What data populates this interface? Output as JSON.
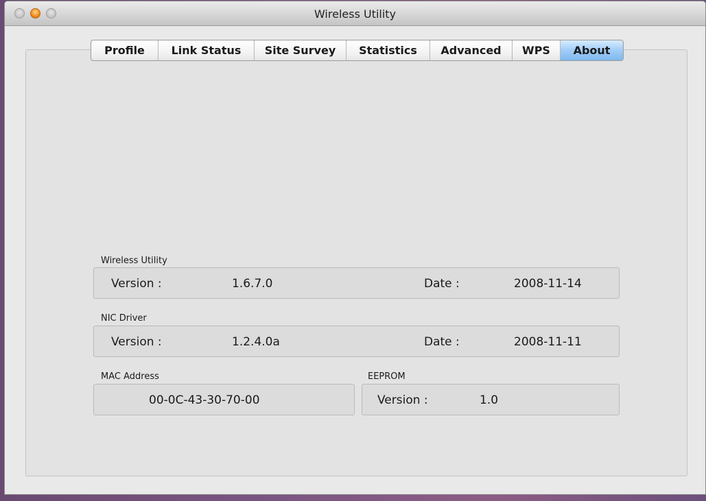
{
  "window": {
    "title": "Wireless Utility"
  },
  "tabs": [
    {
      "label": "Profile"
    },
    {
      "label": "Link Status"
    },
    {
      "label": "Site Survey"
    },
    {
      "label": "Statistics"
    },
    {
      "label": "Advanced"
    },
    {
      "label": "WPS"
    },
    {
      "label": "About"
    }
  ],
  "active_tab": "About",
  "wireless_utility": {
    "group_label": "Wireless Utility",
    "version_label": "Version :",
    "version": "1.6.7.0",
    "date_label": "Date :",
    "date": "2008-11-14"
  },
  "nic_driver": {
    "group_label": "NIC Driver",
    "version_label": "Version :",
    "version": "1.2.4.0a",
    "date_label": "Date :",
    "date": "2008-11-11"
  },
  "mac_address": {
    "group_label": "MAC Address",
    "value": "00-0C-43-30-70-00"
  },
  "eeprom": {
    "group_label": "EEPROM",
    "version_label": "Version :",
    "version": "1.0"
  },
  "colors": {
    "active_tab": "#9fcdf7",
    "close_button": "#b3b3b3",
    "minimize_button": "#f08a1c"
  }
}
